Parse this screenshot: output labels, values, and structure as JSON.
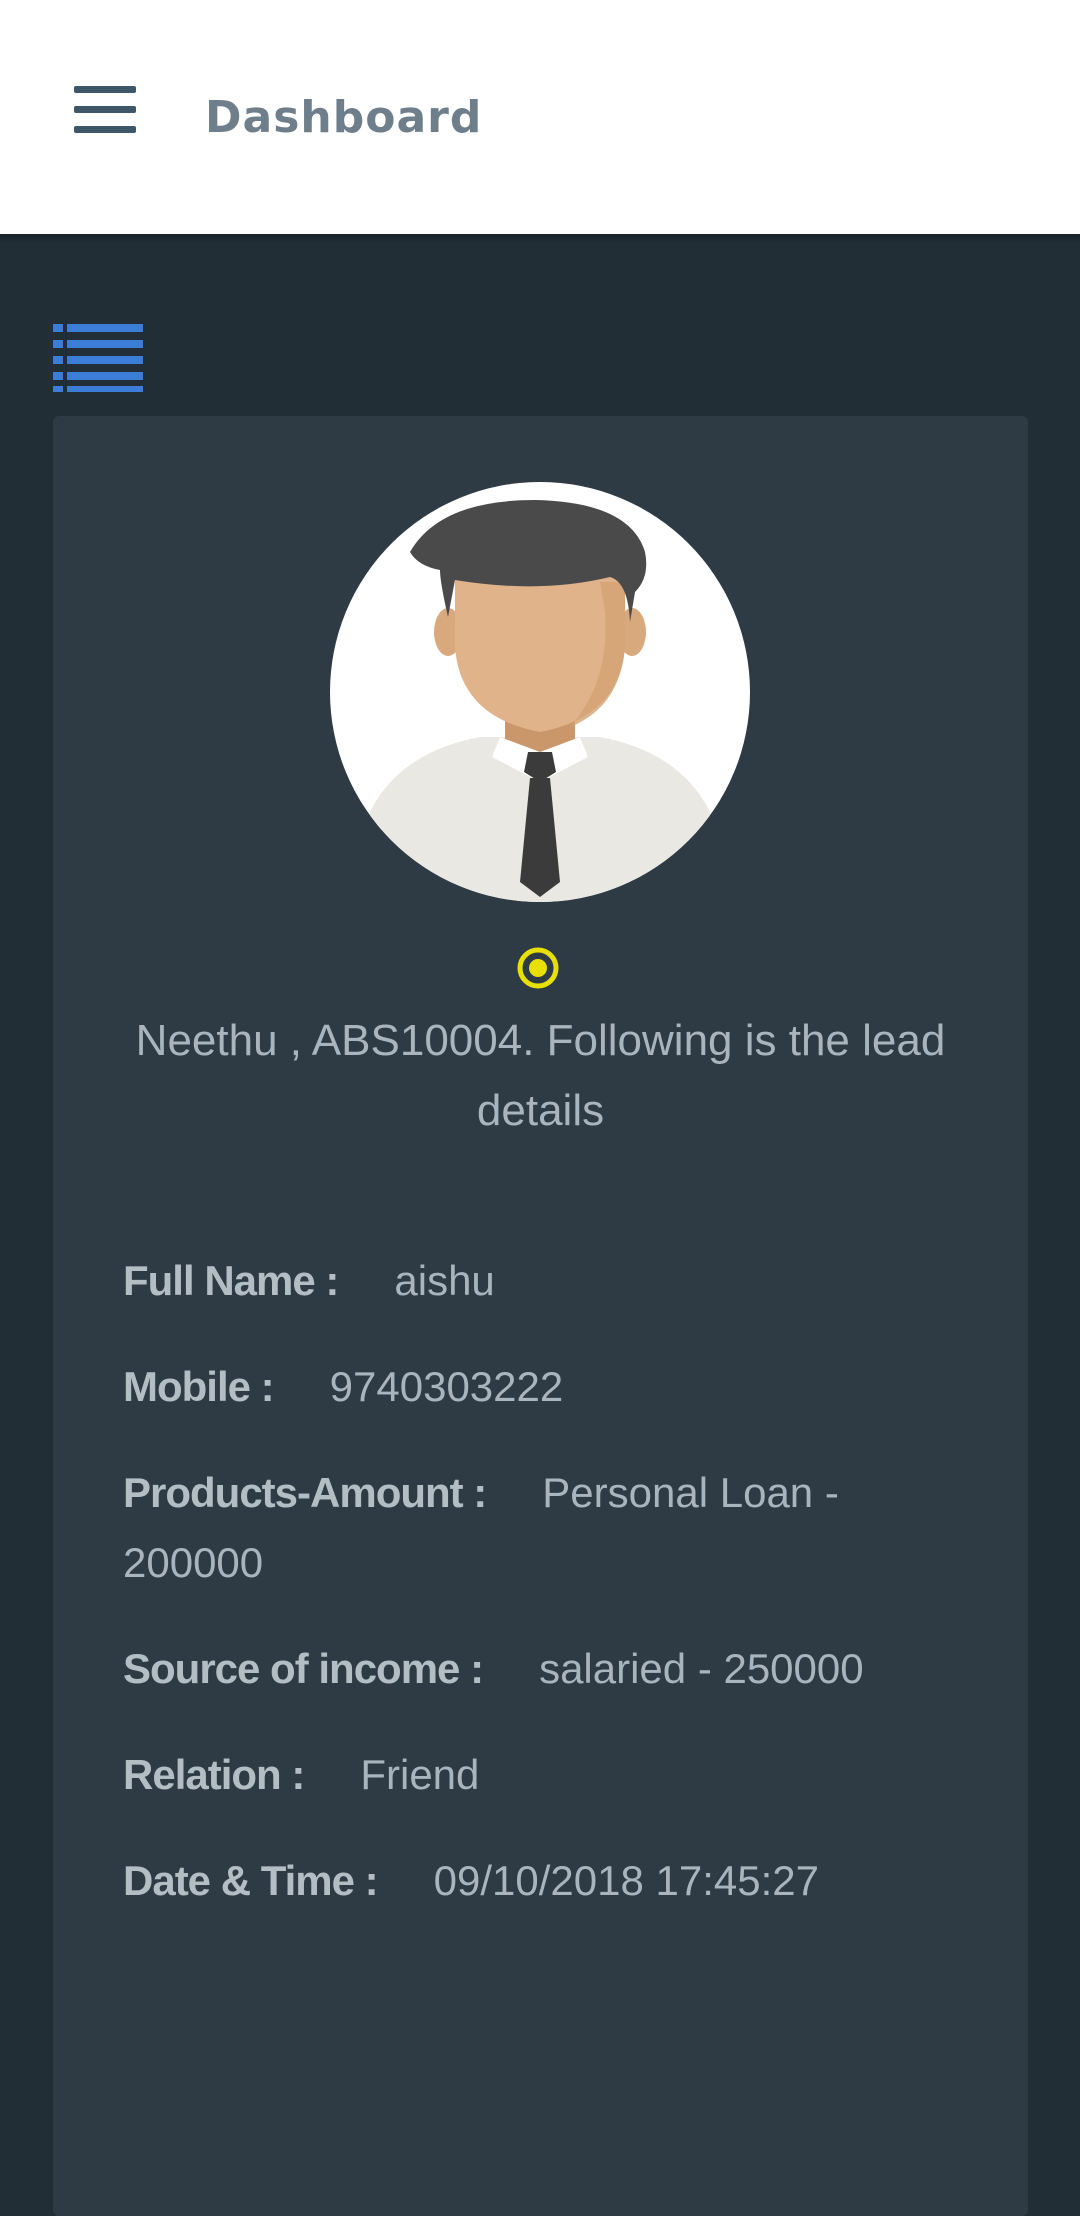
{
  "header": {
    "title": "Dashboard",
    "menu_icon": "hamburger-menu-icon"
  },
  "colors": {
    "header_bg": "#ffffff",
    "page_bg": "#222e36",
    "card_bg": "#2e3b45",
    "accent": "#3b7dd8",
    "status": "#e8e000",
    "text": "#a9b4bc",
    "header_text": "#6e7f8b"
  },
  "toolbar": {
    "list_icon": "list-view-icon"
  },
  "profile": {
    "avatar_icon": "user-avatar-icon",
    "status_icon": "status-indicator-icon",
    "greeting": "Neethu , ABS10004. Following is the lead details"
  },
  "lead": {
    "rows": [
      {
        "label": "Full Name :",
        "value": "aishu"
      },
      {
        "label": "Mobile :",
        "value": "9740303222"
      },
      {
        "label": "Products-Amount :",
        "value": "Personal Loan - 200000"
      },
      {
        "label": "Source of income :",
        "value": "salaried - 250000"
      },
      {
        "label": "Relation :",
        "value": "Friend"
      },
      {
        "label": "Date & Time :",
        "value": "09/10/2018 17:45:27"
      }
    ]
  }
}
